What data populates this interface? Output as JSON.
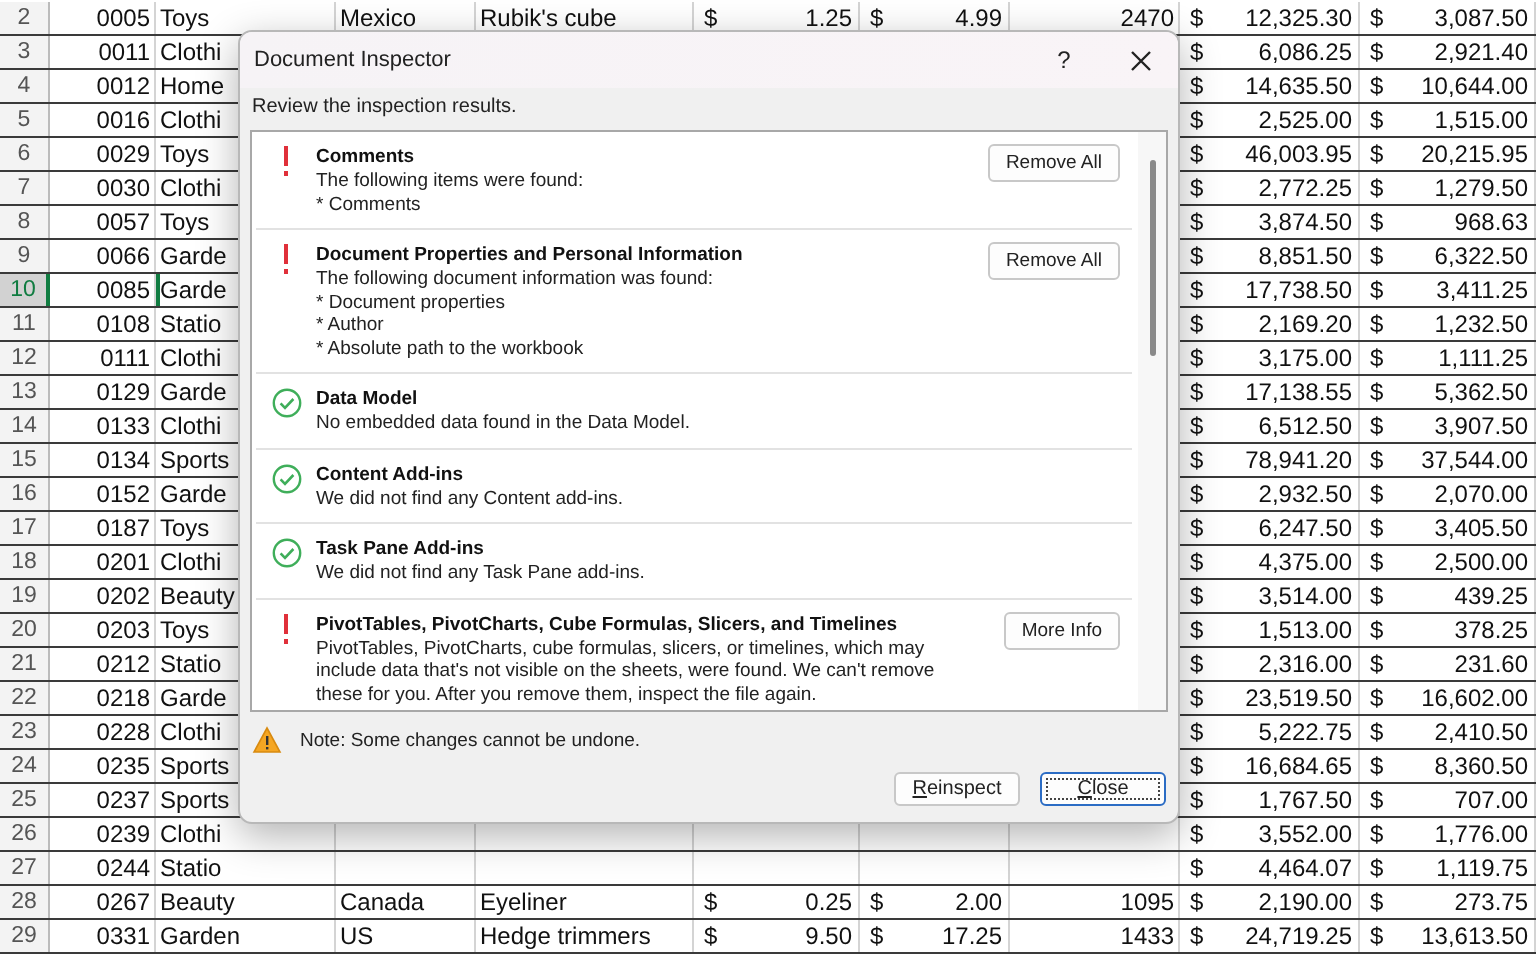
{
  "sheet": {
    "rows": [
      {
        "row": "2",
        "selected": false,
        "id": "0005",
        "category": "Toys",
        "country": "Mexico",
        "product": "Rubik's cube",
        "price": {
          "symbol": "$",
          "value": "1.25"
        },
        "cost": {
          "symbol": "$",
          "value": "4.99"
        },
        "qty": "2470",
        "total": {
          "symbol": "$",
          "value": "12,325.30"
        },
        "profit": {
          "symbol": "$",
          "value": "3,087.50"
        }
      },
      {
        "row": "3",
        "selected": false,
        "id": "0011",
        "category": "Clothi",
        "total": {
          "symbol": "$",
          "value": "6,086.25"
        },
        "profit": {
          "symbol": "$",
          "value": "2,921.40"
        }
      },
      {
        "row": "4",
        "selected": false,
        "id": "0012",
        "category": "Home",
        "total": {
          "symbol": "$",
          "value": "14,635.50"
        },
        "profit": {
          "symbol": "$",
          "value": "10,644.00"
        }
      },
      {
        "row": "5",
        "selected": false,
        "id": "0016",
        "category": "Clothi",
        "total": {
          "symbol": "$",
          "value": "2,525.00"
        },
        "profit": {
          "symbol": "$",
          "value": "1,515.00"
        }
      },
      {
        "row": "6",
        "selected": false,
        "id": "0029",
        "category": "Toys",
        "total": {
          "symbol": "$",
          "value": "46,003.95"
        },
        "profit": {
          "symbol": "$",
          "value": "20,215.95"
        }
      },
      {
        "row": "7",
        "selected": false,
        "id": "0030",
        "category": "Clothi",
        "total": {
          "symbol": "$",
          "value": "2,772.25"
        },
        "profit": {
          "symbol": "$",
          "value": "1,279.50"
        }
      },
      {
        "row": "8",
        "selected": false,
        "id": "0057",
        "category": "Toys",
        "total": {
          "symbol": "$",
          "value": "3,874.50"
        },
        "profit": {
          "symbol": "$",
          "value": "968.63"
        }
      },
      {
        "row": "9",
        "selected": false,
        "id": "0066",
        "category": "Garde",
        "total": {
          "symbol": "$",
          "value": "8,851.50"
        },
        "profit": {
          "symbol": "$",
          "value": "6,322.50"
        }
      },
      {
        "row": "10",
        "selected": true,
        "id": "0085",
        "category": "Garde",
        "total": {
          "symbol": "$",
          "value": "17,738.50"
        },
        "profit": {
          "symbol": "$",
          "value": "3,411.25"
        }
      },
      {
        "row": "11",
        "selected": false,
        "id": "0108",
        "category": "Statio",
        "total": {
          "symbol": "$",
          "value": "2,169.20"
        },
        "profit": {
          "symbol": "$",
          "value": "1,232.50"
        }
      },
      {
        "row": "12",
        "selected": false,
        "id": "0111",
        "category": "Clothi",
        "total": {
          "symbol": "$",
          "value": "3,175.00"
        },
        "profit": {
          "symbol": "$",
          "value": "1,111.25"
        }
      },
      {
        "row": "13",
        "selected": false,
        "id": "0129",
        "category": "Garde",
        "total": {
          "symbol": "$",
          "value": "17,138.55"
        },
        "profit": {
          "symbol": "$",
          "value": "5,362.50"
        }
      },
      {
        "row": "14",
        "selected": false,
        "id": "0133",
        "category": "Clothi",
        "total": {
          "symbol": "$",
          "value": "6,512.50"
        },
        "profit": {
          "symbol": "$",
          "value": "3,907.50"
        }
      },
      {
        "row": "15",
        "selected": false,
        "id": "0134",
        "category": "Sports",
        "total": {
          "symbol": "$",
          "value": "78,941.20"
        },
        "profit": {
          "symbol": "$",
          "value": "37,544.00"
        }
      },
      {
        "row": "16",
        "selected": false,
        "id": "0152",
        "category": "Garde",
        "total": {
          "symbol": "$",
          "value": "2,932.50"
        },
        "profit": {
          "symbol": "$",
          "value": "2,070.00"
        }
      },
      {
        "row": "17",
        "selected": false,
        "id": "0187",
        "category": "Toys",
        "total": {
          "symbol": "$",
          "value": "6,247.50"
        },
        "profit": {
          "symbol": "$",
          "value": "3,405.50"
        }
      },
      {
        "row": "18",
        "selected": false,
        "id": "0201",
        "category": "Clothi",
        "total": {
          "symbol": "$",
          "value": "4,375.00"
        },
        "profit": {
          "symbol": "$",
          "value": "2,500.00"
        }
      },
      {
        "row": "19",
        "selected": false,
        "id": "0202",
        "category": "Beauty",
        "total": {
          "symbol": "$",
          "value": "3,514.00"
        },
        "profit": {
          "symbol": "$",
          "value": "439.25"
        }
      },
      {
        "row": "20",
        "selected": false,
        "id": "0203",
        "category": "Toys",
        "total": {
          "symbol": "$",
          "value": "1,513.00"
        },
        "profit": {
          "symbol": "$",
          "value": "378.25"
        }
      },
      {
        "row": "21",
        "selected": false,
        "id": "0212",
        "category": "Statio",
        "total": {
          "symbol": "$",
          "value": "2,316.00"
        },
        "profit": {
          "symbol": "$",
          "value": "231.60"
        }
      },
      {
        "row": "22",
        "selected": false,
        "id": "0218",
        "category": "Garde",
        "total": {
          "symbol": "$",
          "value": "23,519.50"
        },
        "profit": {
          "symbol": "$",
          "value": "16,602.00"
        }
      },
      {
        "row": "23",
        "selected": false,
        "id": "0228",
        "category": "Clothi",
        "total": {
          "symbol": "$",
          "value": "5,222.75"
        },
        "profit": {
          "symbol": "$",
          "value": "2,410.50"
        }
      },
      {
        "row": "24",
        "selected": false,
        "id": "0235",
        "category": "Sports",
        "total": {
          "symbol": "$",
          "value": "16,684.65"
        },
        "profit": {
          "symbol": "$",
          "value": "8,360.50"
        }
      },
      {
        "row": "25",
        "selected": false,
        "id": "0237",
        "category": "Sports",
        "total": {
          "symbol": "$",
          "value": "1,767.50"
        },
        "profit": {
          "symbol": "$",
          "value": "707.00"
        }
      },
      {
        "row": "26",
        "selected": false,
        "id": "0239",
        "category": "Clothi",
        "total": {
          "symbol": "$",
          "value": "3,552.00"
        },
        "profit": {
          "symbol": "$",
          "value": "1,776.00"
        }
      },
      {
        "row": "27",
        "selected": false,
        "id": "0244",
        "category": "Statio",
        "total": {
          "symbol": "$",
          "value": "4,464.07"
        },
        "profit": {
          "symbol": "$",
          "value": "1,119.75"
        }
      },
      {
        "row": "28",
        "selected": false,
        "id": "0267",
        "category": "Beauty",
        "country": "Canada",
        "product": "Eyeliner",
        "price": {
          "symbol": "$",
          "value": "0.25"
        },
        "cost": {
          "symbol": "$",
          "value": "2.00"
        },
        "qty": "1095",
        "total": {
          "symbol": "$",
          "value": "2,190.00"
        },
        "profit": {
          "symbol": "$",
          "value": "273.75"
        }
      },
      {
        "row": "29",
        "selected": false,
        "id": "0331",
        "category": "Garden",
        "country": "US",
        "product": "Hedge trimmers",
        "price": {
          "symbol": "$",
          "value": "9.50"
        },
        "cost": {
          "symbol": "$",
          "value": "17.25"
        },
        "qty": "1433",
        "total": {
          "symbol": "$",
          "value": "24,719.25"
        },
        "profit": {
          "symbol": "$",
          "value": "13,613.50"
        }
      }
    ]
  },
  "dialog": {
    "title": "Document Inspector",
    "help": "?",
    "instruction": "Review the inspection results.",
    "results": [
      {
        "kind": "issue",
        "title": "Comments",
        "lines": [
          "The following items were found:",
          "* Comments"
        ],
        "button": "Remove All"
      },
      {
        "kind": "issue",
        "title": "Document Properties and Personal Information",
        "lines": [
          "The following document information was found:",
          "* Document properties",
          "* Author",
          "* Absolute path to the workbook"
        ],
        "button": "Remove All"
      },
      {
        "kind": "clean",
        "title": "Data Model",
        "lines": [
          "No embedded data found in the Data Model."
        ]
      },
      {
        "kind": "clean",
        "title": "Content Add-ins",
        "lines": [
          "We did not find any Content add-ins."
        ]
      },
      {
        "kind": "clean",
        "title": "Task Pane Add-ins",
        "lines": [
          "We did not find any Task Pane add-ins."
        ]
      },
      {
        "kind": "issue",
        "title": "PivotTables, PivotCharts, Cube Formulas, Slicers, and Timelines",
        "lines": [
          "PivotTables, PivotCharts, cube formulas, slicers, or timelines, which may include data that's not visible on the sheets, were found. We can't remove these for you. After you remove them, inspect the file again."
        ],
        "button": "More Info"
      }
    ],
    "note": "Note: Some changes cannot be undone.",
    "buttons": [
      {
        "label": "Reinspect",
        "focused": false
      },
      {
        "label": "Close",
        "focused": true
      }
    ]
  }
}
